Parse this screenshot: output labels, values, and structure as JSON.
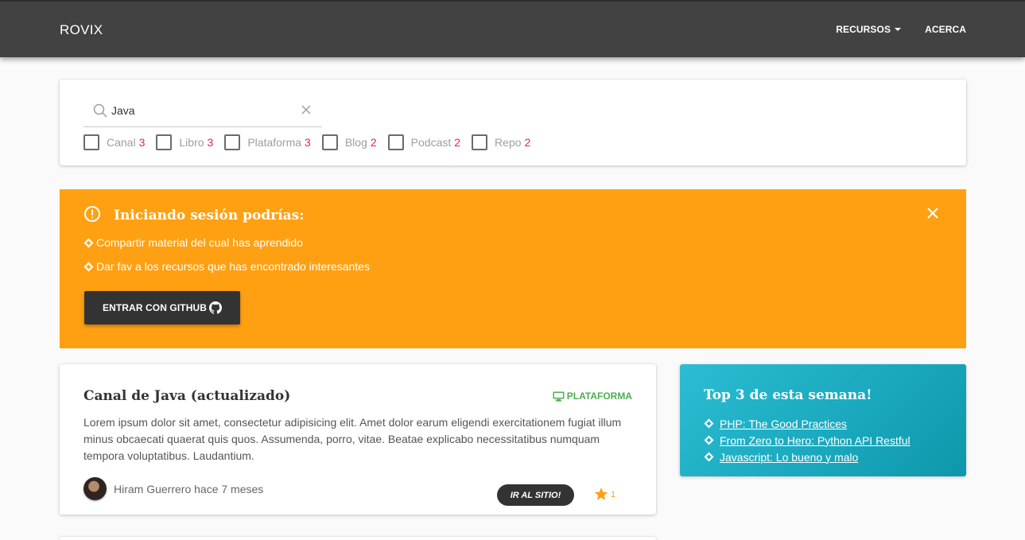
{
  "topbar": {
    "brand": "ROVIX",
    "nav": {
      "resources": "RECURSOS",
      "about": "ACERCA"
    }
  },
  "search": {
    "value": "Java",
    "filters": [
      {
        "label": "Canal",
        "count": "3"
      },
      {
        "label": "Libro",
        "count": "3"
      },
      {
        "label": "Plataforma",
        "count": "3"
      },
      {
        "label": "Blog",
        "count": "2"
      },
      {
        "label": "Podcast",
        "count": "2"
      },
      {
        "label": "Repo",
        "count": "2"
      }
    ]
  },
  "alert": {
    "title": "Iniciando sesión podrías:",
    "items": [
      "Compartir material del cual has aprendido",
      "Dar fav a los recursos que has encontrado interesantes"
    ],
    "button": "ENTRAR CON GITHUB",
    "color": "#ffa012"
  },
  "resource": {
    "title": "Canal de Java (actualizado)",
    "type": "PLATAFORMA",
    "description": "Lorem ipsum dolor sit amet, consectetur adipisicing elit. Amet dolor earum eligendi exercitationem fugiat illum minus obcaecati quaerat quis quos. Assumenda, porro, vitae. Beatae explicabo necessitatibus numquam tempora voluptatibus. Laudantium.",
    "author": "Hiram Guerrero hace 7 meses",
    "go_button": "IR AL SITIO!",
    "favs": "1"
  },
  "top": {
    "title": "Top 3 de esta semana!",
    "items": [
      "PHP: The Good Practices",
      "From Zero to Hero: Python API Restful",
      "Javascript: Lo bueno y malo"
    ]
  }
}
